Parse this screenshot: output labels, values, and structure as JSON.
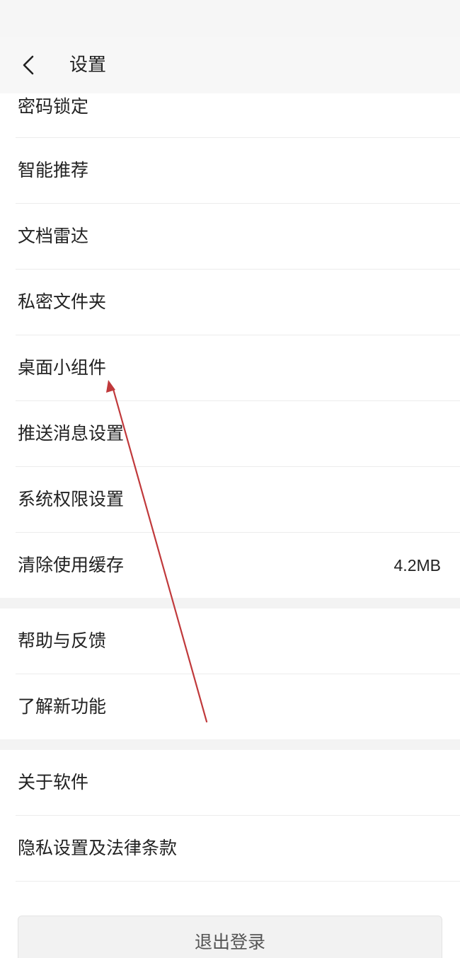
{
  "header": {
    "title": "设置",
    "back_icon": "chevron-left-icon"
  },
  "settings": {
    "items": [
      {
        "label": "密码锁定"
      },
      {
        "label": "智能推荐"
      },
      {
        "label": "文档雷达"
      },
      {
        "label": "私密文件夹"
      },
      {
        "label": "桌面小组件"
      },
      {
        "label": "推送消息设置"
      },
      {
        "label": "系统权限设置"
      },
      {
        "label": "清除使用缓存",
        "value": "4.2MB"
      },
      {
        "label": "帮助与反馈"
      },
      {
        "label": "了解新功能"
      },
      {
        "label": "关于软件"
      },
      {
        "label": "隐私设置及法律条款"
      }
    ]
  },
  "logout": {
    "label": "退出登录"
  },
  "annotation": {
    "arrow_color": "#c0393b",
    "points_to": "桌面小组件"
  }
}
